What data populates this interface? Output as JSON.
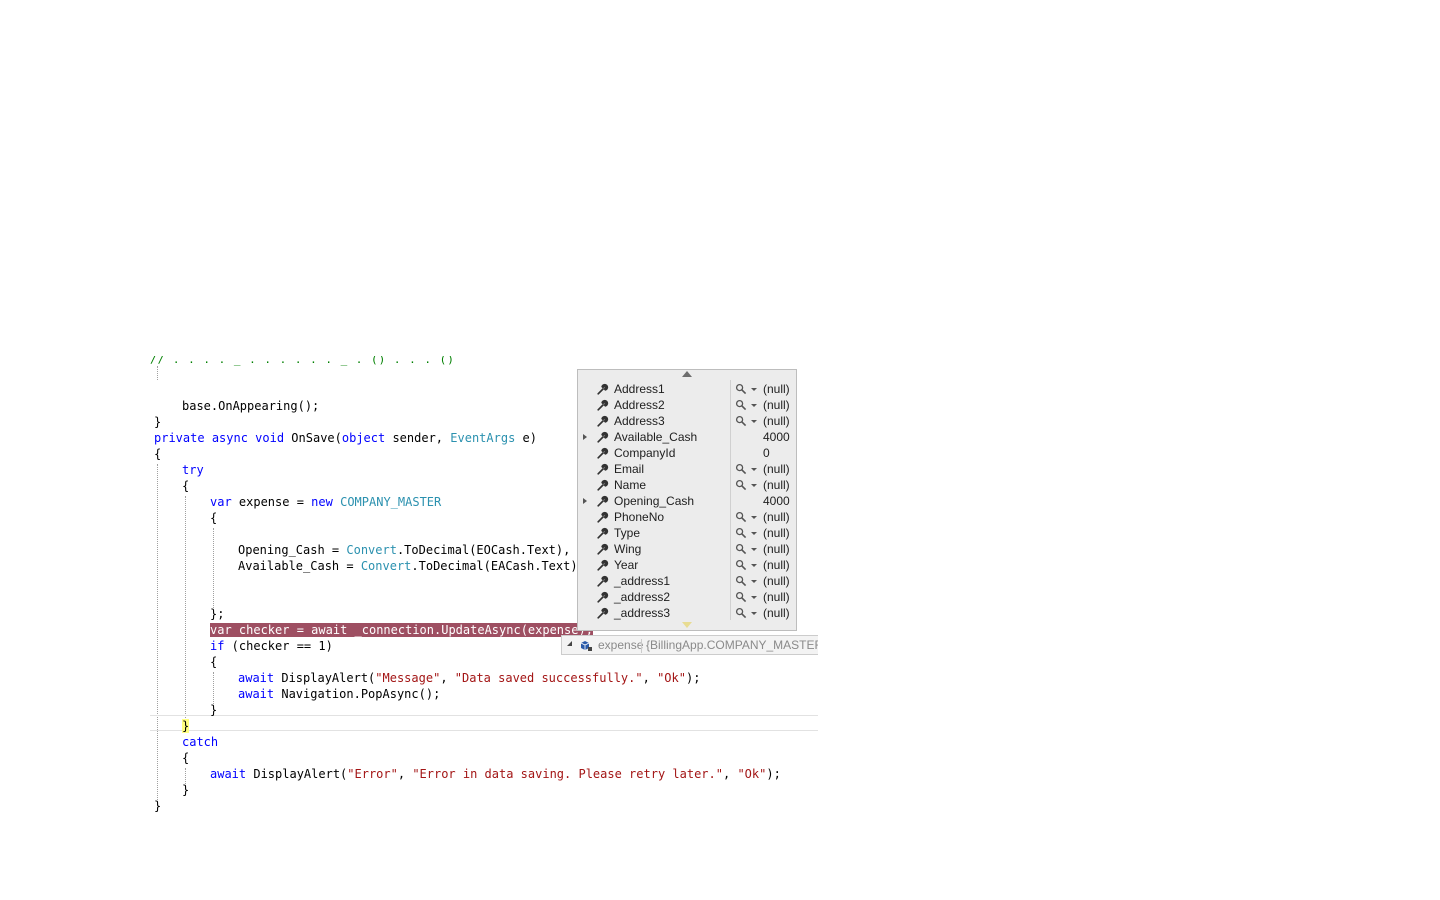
{
  "code": {
    "top_partial": "//   .  .   .   . _  . . . .   .   . _  .  ()  . .  . ()",
    "lines": [
      {
        "tokens": [
          {
            "t": "base.OnAppearing();",
            "c": ""
          }
        ]
      },
      {
        "tokens": [
          {
            "t": "}",
            "c": ""
          }
        ]
      },
      {
        "tokens": [
          {
            "t": "private",
            "c": "kw"
          },
          {
            "t": " ",
            "c": ""
          },
          {
            "t": "async",
            "c": "kw"
          },
          {
            "t": " ",
            "c": ""
          },
          {
            "t": "void",
            "c": "kw"
          },
          {
            "t": " OnSave(",
            "c": ""
          },
          {
            "t": "object",
            "c": "kw"
          },
          {
            "t": " sender, ",
            "c": ""
          },
          {
            "t": "EventArgs",
            "c": "ty"
          },
          {
            "t": " e)",
            "c": ""
          }
        ]
      },
      {
        "tokens": [
          {
            "t": "{",
            "c": ""
          }
        ]
      },
      {
        "tokens": [
          {
            "t": "try",
            "c": "kw"
          }
        ]
      },
      {
        "tokens": [
          {
            "t": "{",
            "c": ""
          }
        ]
      },
      {
        "tokens": [
          {
            "t": "var",
            "c": "kw"
          },
          {
            "t": " expense = ",
            "c": ""
          },
          {
            "t": "new",
            "c": "kw"
          },
          {
            "t": " ",
            "c": ""
          },
          {
            "t": "COMPANY_MASTER",
            "c": "ty"
          }
        ]
      },
      {
        "tokens": [
          {
            "t": "{",
            "c": ""
          }
        ]
      },
      {
        "tokens": [
          {
            "t": "Opening_Cash = ",
            "c": ""
          },
          {
            "t": "Convert",
            "c": "ty"
          },
          {
            "t": ".ToDecimal(EOCash.Text),",
            "c": ""
          }
        ]
      },
      {
        "tokens": [
          {
            "t": "Available_Cash = ",
            "c": ""
          },
          {
            "t": "Convert",
            "c": "ty"
          },
          {
            "t": ".ToDecimal(EACash.Text)",
            "c": ""
          }
        ]
      },
      {
        "tokens": [
          {
            "t": "};",
            "c": ""
          }
        ]
      },
      {
        "tokens": [
          {
            "t": "var",
            "c": "kw"
          },
          {
            "t": " checker = ",
            "c": ""
          },
          {
            "t": "await",
            "c": "kw"
          },
          {
            "t": " _connection.UpdateAsync(expense);",
            "c": ""
          }
        ]
      },
      {
        "tokens": [
          {
            "t": "if",
            "c": "kw"
          },
          {
            "t": " (checker == 1)",
            "c": ""
          }
        ]
      },
      {
        "tokens": [
          {
            "t": "{",
            "c": ""
          }
        ]
      },
      {
        "tokens": [
          {
            "t": "await",
            "c": "kw"
          },
          {
            "t": " DisplayAlert(",
            "c": ""
          },
          {
            "t": "\"Message\"",
            "c": "st"
          },
          {
            "t": ", ",
            "c": ""
          },
          {
            "t": "\"Data saved successfully.\"",
            "c": "st"
          },
          {
            "t": ", ",
            "c": ""
          },
          {
            "t": "\"Ok\"",
            "c": "st"
          },
          {
            "t": ");",
            "c": ""
          }
        ]
      },
      {
        "tokens": [
          {
            "t": "await",
            "c": "kw"
          },
          {
            "t": " Navigation.PopAsync();",
            "c": ""
          }
        ]
      },
      {
        "tokens": [
          {
            "t": "}",
            "c": ""
          }
        ]
      },
      {
        "tokens": [
          {
            "t": "}",
            "c": ""
          }
        ]
      },
      {
        "tokens": [
          {
            "t": "catch",
            "c": "kw"
          }
        ]
      },
      {
        "tokens": [
          {
            "t": "{",
            "c": ""
          }
        ]
      },
      {
        "tokens": [
          {
            "t": "await",
            "c": "kw"
          },
          {
            "t": " DisplayAlert(",
            "c": ""
          },
          {
            "t": "\"Error\"",
            "c": "st"
          },
          {
            "t": ", ",
            "c": ""
          },
          {
            "t": "\"Error in data saving. Please retry later.\"",
            "c": "st"
          },
          {
            "t": ", ",
            "c": ""
          },
          {
            "t": "\"Ok\"",
            "c": "st"
          },
          {
            "t": ");",
            "c": ""
          }
        ]
      },
      {
        "tokens": [
          {
            "t": "}",
            "c": ""
          }
        ]
      },
      {
        "tokens": [
          {
            "t": "}",
            "c": ""
          }
        ]
      }
    ]
  },
  "datatip": {
    "variable_name": "expense",
    "variable_value": "{BillingApp.COMPANY_MASTER}",
    "properties": [
      {
        "name": "Address1",
        "value": "(null)",
        "expandable": false,
        "search": true
      },
      {
        "name": "Address2",
        "value": "(null)",
        "expandable": false,
        "search": true
      },
      {
        "name": "Address3",
        "value": "(null)",
        "expandable": false,
        "search": true
      },
      {
        "name": "Available_Cash",
        "value": "4000",
        "expandable": true,
        "search": false
      },
      {
        "name": "CompanyId",
        "value": "0",
        "expandable": false,
        "search": false
      },
      {
        "name": "Email",
        "value": "(null)",
        "expandable": false,
        "search": true
      },
      {
        "name": "Name",
        "value": "(null)",
        "expandable": false,
        "search": true
      },
      {
        "name": "Opening_Cash",
        "value": "4000",
        "expandable": true,
        "search": false
      },
      {
        "name": "PhoneNo",
        "value": "(null)",
        "expandable": false,
        "search": true
      },
      {
        "name": "Type",
        "value": "(null)",
        "expandable": false,
        "search": true
      },
      {
        "name": "Wing",
        "value": "(null)",
        "expandable": false,
        "search": true
      },
      {
        "name": "Year",
        "value": "(null)",
        "expandable": false,
        "search": true
      },
      {
        "name": "_address1",
        "value": "(null)",
        "expandable": false,
        "search": true
      },
      {
        "name": "_address2",
        "value": "(null)",
        "expandable": false,
        "search": true
      },
      {
        "name": "_address3",
        "value": "(null)",
        "expandable": false,
        "search": true
      }
    ]
  },
  "colors": {
    "keyword": "#0000ff",
    "type": "#2b91af",
    "string": "#a31515",
    "breakpoint_line": "#9e4f62",
    "brace_highlight": "#ffff80"
  },
  "icons": {
    "property": "wrench-icon",
    "visualizer": "magnifier-icon",
    "object": "object-icon"
  }
}
